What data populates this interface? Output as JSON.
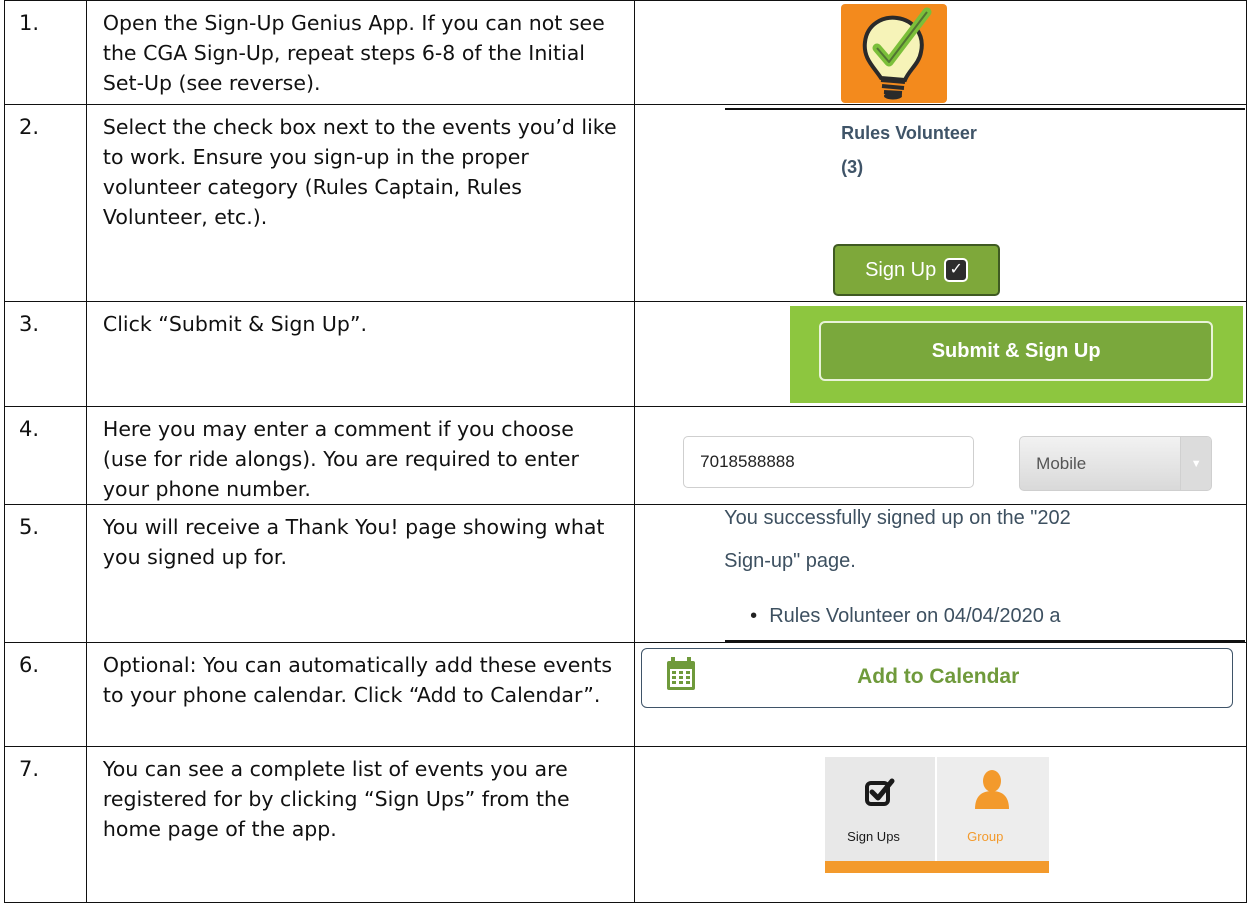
{
  "steps": [
    {
      "num": "1.",
      "text": "Open the Sign-Up Genius App. If you can not see the CGA Sign-Up, repeat steps 6-8 of the Initial Set-Up (see reverse)."
    },
    {
      "num": "2.",
      "text": "Select the check box next to the events you’d like to work. Ensure you sign-up in the proper volunteer category (Rules Captain, Rules Volunteer, etc.)."
    },
    {
      "num": "3.",
      "text": "Click “Submit & Sign Up”."
    },
    {
      "num": "4.",
      "text": "Here you may enter a comment if you choose (use for ride alongs). You are required to enter your phone number."
    },
    {
      "num": "5.",
      "text": "You will receive a Thank You! page showing what you signed up for."
    },
    {
      "num": "6.",
      "text": "Optional: You can automatically add these events to your phone calendar. Click “Add to Calendar”."
    },
    {
      "num": "7.",
      "text": "You can see a complete list of events you are registered for by clicking “Sign Ups” from the home page of the app."
    }
  ],
  "shots": {
    "logo_icon": "lightbulb-check-icon",
    "rules_title": "Rules Volunteer",
    "rules_count": "(3)",
    "signup_button": "Sign Up",
    "submit_button": "Submit & Sign Up",
    "phone_value": "7018588888",
    "phone_type": "Mobile",
    "thankyou_line1": "You successfully signed up on the \"202",
    "thankyou_line2": "Sign-up\" page.",
    "thankyou_bullet": "Rules Volunteer on 04/04/2020 a",
    "calendar_button": "Add to Calendar",
    "tab_signups": "Sign Ups",
    "tab_groups": "Group"
  },
  "colors": {
    "logo_orange": "#f38a1d",
    "green_button": "#7ea83a",
    "green_bar": "#8dc63f",
    "calendar_green": "#6f9a3b",
    "text_slate": "#3f5468",
    "tab_orange": "#f39a2c"
  }
}
